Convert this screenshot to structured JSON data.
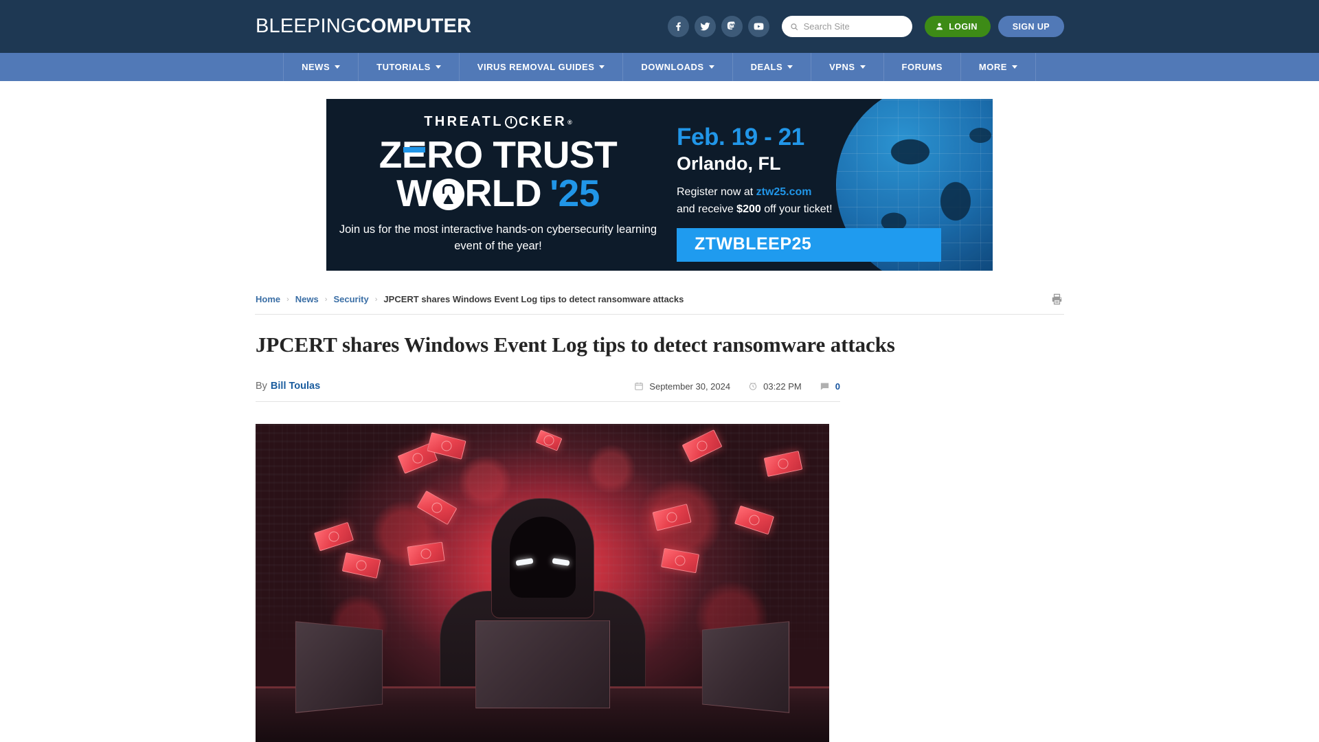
{
  "site": {
    "logo_light": "BLEEPING",
    "logo_bold": "COMPUTER",
    "social": [
      {
        "name": "facebook-icon",
        "label": "Facebook"
      },
      {
        "name": "twitter-icon",
        "label": "Twitter"
      },
      {
        "name": "mastodon-icon",
        "label": "Mastodon"
      },
      {
        "name": "youtube-icon",
        "label": "YouTube"
      }
    ],
    "search": {
      "placeholder": "Search Site",
      "value": ""
    },
    "login_label": "LOGIN",
    "signup_label": "SIGN UP",
    "colors": {
      "header_bg": "#1e3853",
      "nav_bg": "#5179b7",
      "login_green": "#3d8b16",
      "link_blue": "#3a6ea5"
    }
  },
  "nav": {
    "items": [
      {
        "label": "NEWS",
        "has_dropdown": true
      },
      {
        "label": "TUTORIALS",
        "has_dropdown": true
      },
      {
        "label": "VIRUS REMOVAL GUIDES",
        "has_dropdown": true
      },
      {
        "label": "DOWNLOADS",
        "has_dropdown": true
      },
      {
        "label": "DEALS",
        "has_dropdown": true
      },
      {
        "label": "VPNS",
        "has_dropdown": true
      },
      {
        "label": "FORUMS",
        "has_dropdown": false
      },
      {
        "label": "MORE",
        "has_dropdown": true
      }
    ]
  },
  "ad": {
    "brand": "THREATL",
    "brand_tail": "CKER",
    "registered_mark": "®",
    "headline_line1_a": "Z",
    "headline_line1_b": "RO TRUST",
    "headline_line2_a": "W",
    "headline_line2_b": "RLD",
    "headline_year": "'25",
    "subtext": "Join us for the most interactive hands-on cybersecurity learning event of the year!",
    "dates": "Feb. 19 - 21",
    "city": "Orlando, FL",
    "register_prefix": "Register now at ",
    "register_link": "ztw25.com",
    "register_mid": "and receive ",
    "register_amount": "$200",
    "register_suffix": " off your ticket!",
    "promo_code": "ZTWBLEEP25",
    "accent": "#2196e8"
  },
  "breadcrumb": {
    "items": [
      {
        "label": "Home",
        "link": true
      },
      {
        "label": "News",
        "link": true
      },
      {
        "label": "Security",
        "link": true
      },
      {
        "label": "JPCERT shares Windows Event Log tips to detect ransomware attacks",
        "link": false
      }
    ],
    "separator": "›",
    "print_label": "Print"
  },
  "article": {
    "title": "JPCERT shares Windows Event Log tips to detect ransomware attacks",
    "by_label": "By",
    "author": "Bill Toulas",
    "date": "September 30, 2024",
    "time": "03:22 PM",
    "comment_count": "0",
    "hero_alt": "Hooded hacker at laptops with red glow and flying money"
  }
}
